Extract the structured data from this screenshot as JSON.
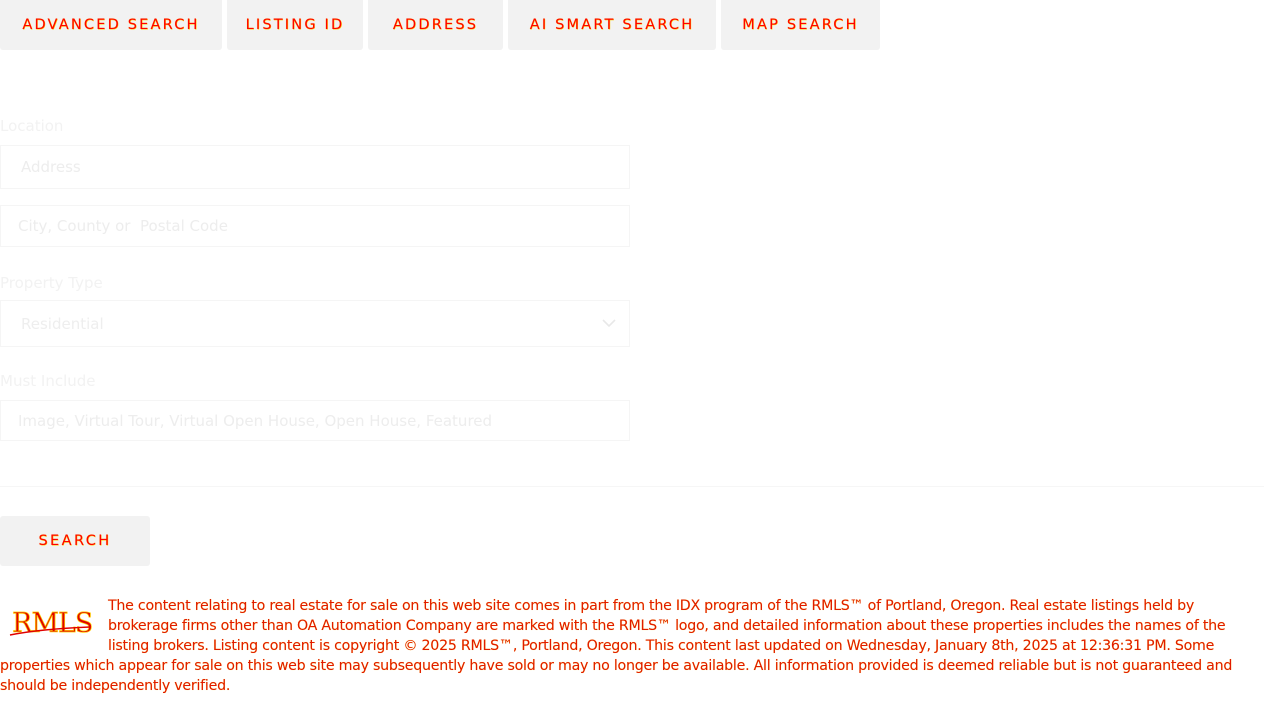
{
  "tabs": [
    {
      "label": "ADVANCED SEARCH"
    },
    {
      "label": "LISTING ID"
    },
    {
      "label": "ADDRESS"
    },
    {
      "label": "AI SMART SEARCH"
    },
    {
      "label": "MAP SEARCH"
    }
  ],
  "form": {
    "location_label": "Location",
    "address_placeholder": "Address",
    "city_placeholder": "City, County or  Postal Code",
    "property_type_label": "Property Type",
    "property_type_value": "Residential",
    "must_include_label": "Must Include",
    "must_include_placeholder": "Image, Virtual Tour, Virtual Open House, Open House, Featured",
    "search_label": "SEARCH"
  },
  "disclaimer": {
    "logo_text": "RMLS",
    "text": "The content relating to real estate for sale on this web site comes in part from the IDX program of the RMLS™ of Portland, Oregon. Real estate listings held by brokerage firms other than OA Automation Company are marked with the RMLS™ logo, and detailed information about these properties includes the names of the listing brokers. Listing content is copyright © 2025 RMLS™, Portland, Oregon. This content last updated on Wednesday, January 8th, 2025 at 12:36:31 PM. Some properties which appear for sale on this web site may subsequently have sold or may no longer be available. All information provided is deemed reliable but is not guaranteed and should be independently verified."
  },
  "colors": {
    "accent_text": "#ff0000",
    "accent_glow": "#ffd000",
    "tab_background": "#f2f2f2",
    "faint_text": "#f2f2f2"
  },
  "icons": {
    "select_arrow": "chevron-down-icon",
    "brand_logo": "rmls-logo"
  }
}
